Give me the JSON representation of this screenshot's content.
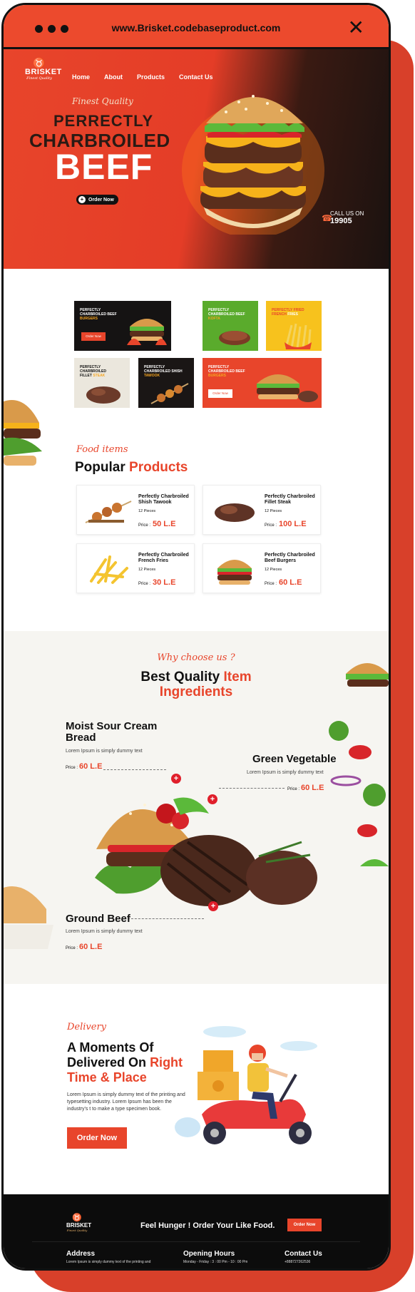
{
  "browser": {
    "url": "www.Brisket.codebaseproduct.com"
  },
  "brand": {
    "name": "BRISKET",
    "tagline": "Finest Quality"
  },
  "nav": {
    "items": [
      "Home",
      "About",
      "Products",
      "Contact Us"
    ]
  },
  "hero": {
    "script": "Finest Quality",
    "line1": "PERRECTLY",
    "line2": "CHARBROILED",
    "line3": "BEEF",
    "cta": "Order Now",
    "call_label": "CALL US ON",
    "call_number": "19905"
  },
  "categories": {
    "tiles": [
      {
        "title": "PERFECTLY CHARBROILED",
        "accent_prefix": "BEEF",
        "accent": "BURGERS",
        "button": "Order Now"
      },
      {
        "title": "PERFECTLY CHARBROILED",
        "accent_prefix": "BEEF",
        "accent": "KOFTA"
      },
      {
        "title": "PERFECTLY FRIED",
        "accent_prefix": "FRENCH",
        "accent": "FRIES"
      },
      {
        "title": "PERFECTLY CHARBROILED",
        "accent_prefix": "FILLET",
        "accent": "STEAK"
      },
      {
        "title": "PERFECTLY CHARBROILED",
        "accent_prefix": "SHISH",
        "accent": "TAWOOK"
      },
      {
        "title": "PERFECTLY CHARBROILED",
        "accent_prefix": "BEEF",
        "accent": "BURGERS",
        "button": "Order Now"
      }
    ]
  },
  "products": {
    "script": "Food items",
    "title_a": "Popular",
    "title_b": "Products",
    "price_label": "Price :",
    "items": [
      {
        "name": "Perfectly Charbroiled Shish Tawook",
        "count": "12 Pieces",
        "price": "50 L.E"
      },
      {
        "name": "Perfectly Charbroiled Fillet Steak",
        "count": "12 Pieces",
        "price": "100 L.E"
      },
      {
        "name": "Perfectly Charbroiled French Fries",
        "count": "12 Pieces",
        "price": "30 L.E"
      },
      {
        "name": "Perfectly Charbroiled Beef Burgers",
        "count": "12 Pieces",
        "price": "60 L.E"
      }
    ]
  },
  "why": {
    "script": "Why choose us ?",
    "title_a": "Best Quality",
    "title_b": "Item",
    "title_c": "Ingredients",
    "price_label": "Price :",
    "ingredients": [
      {
        "title": "Moist Sour Cream Bread",
        "desc": "Lorem Ipsum is simply dummy text",
        "price": "60 L.E"
      },
      {
        "title": "Green Vegetable",
        "desc": "Lorem Ipsum is simply dummy text",
        "price": "60 L.E"
      },
      {
        "title": "Ground Beef",
        "desc": "Lorem Ipsum is simply dummy text",
        "price": "60 L.E"
      }
    ]
  },
  "delivery": {
    "script": "Delivery",
    "title_a": "A Moments Of",
    "title_b": "Delivered On",
    "title_c": "Right",
    "title_d": "Time & Place",
    "desc": "Lorem Ipsum is simply dummy text of the printing and typesetting industry. Lorem Ipsum has been the industry's t to make a type specimen book.",
    "cta": "Order Now"
  },
  "footer": {
    "banner": "Feel Hunger ! Order Your Like Food.",
    "cta": "Order Now",
    "address_title": "Address",
    "address_text": "Lorem Ipsum is simply dummy text of the printing and",
    "hours_title": "Opening Hours",
    "hours_text": "Monday - Friday : 3 : 00 Pm - 10 : 00 Pm",
    "contact_title": "Contact Us",
    "contact_phone": "+888727262536"
  },
  "colors": {
    "brand_red": "#e8452b",
    "dark": "#111111",
    "cream": "#f6f5f1"
  }
}
